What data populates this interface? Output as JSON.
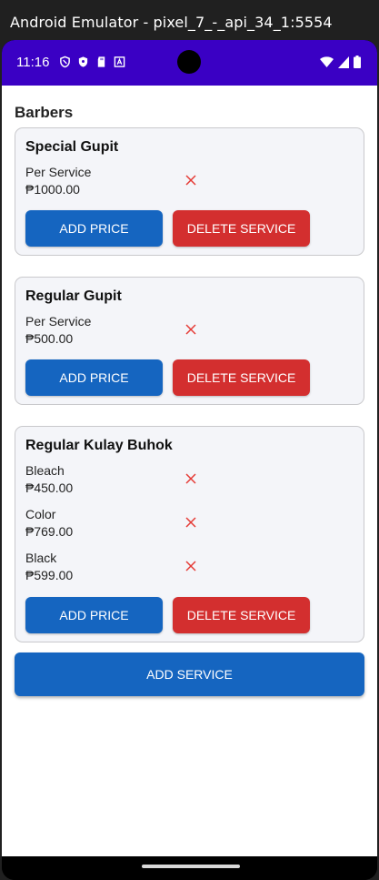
{
  "window": {
    "title": "Android Emulator - pixel_7_-_api_34_1:5554"
  },
  "statusbar": {
    "time": "11:16",
    "colors": {
      "bar": "#3a00c4"
    }
  },
  "screen": {
    "heading": "Barbers",
    "services": [
      {
        "name": "Special Gupit",
        "prices": [
          {
            "label": "Per Service",
            "value": "₱1000.00"
          }
        ],
        "add_price_label": "ADD PRICE",
        "delete_label": "DELETE SERVICE"
      },
      {
        "name": "Regular Gupit",
        "prices": [
          {
            "label": "Per Service",
            "value": "₱500.00"
          }
        ],
        "add_price_label": "ADD PRICE",
        "delete_label": "DELETE SERVICE"
      },
      {
        "name": "Regular Kulay Buhok",
        "prices": [
          {
            "label": "Bleach",
            "value": "₱450.00"
          },
          {
            "label": "Color",
            "value": "₱769.00"
          },
          {
            "label": "Black",
            "value": "₱599.00"
          }
        ],
        "add_price_label": "ADD PRICE",
        "delete_label": "DELETE SERVICE"
      }
    ],
    "add_service_label": "ADD SERVICE",
    "colors": {
      "primary": "#1565c0",
      "danger": "#d32f2f",
      "delete_icon": "#e53935"
    }
  }
}
